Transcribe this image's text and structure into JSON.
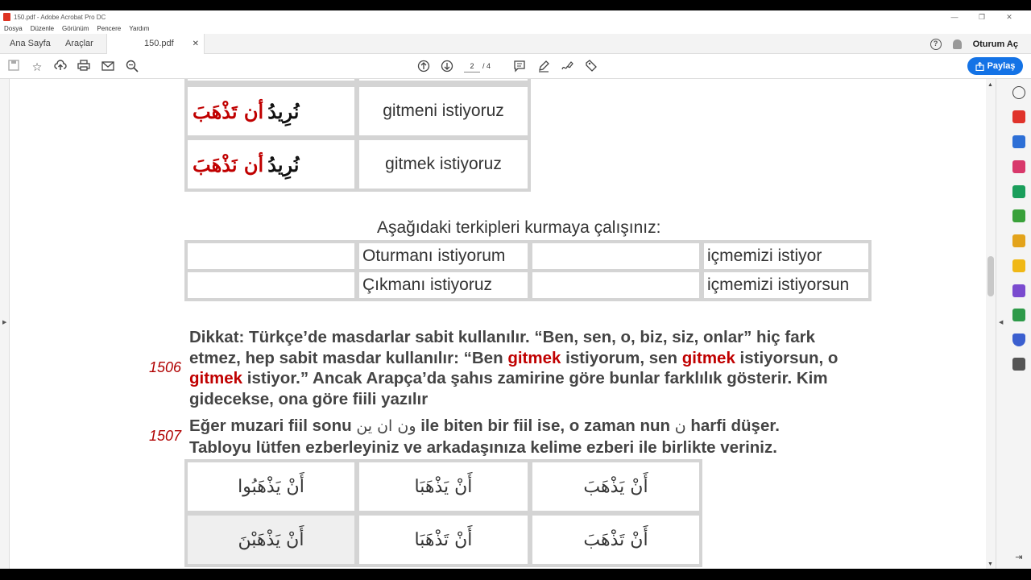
{
  "window": {
    "title": "150.pdf - Adobe Acrobat Pro DC",
    "controls": [
      "—",
      "❐",
      "✕"
    ]
  },
  "menu": [
    "Dosya",
    "Düzenle",
    "Görünüm",
    "Pencere",
    "Yardım"
  ],
  "tabs": {
    "home": "Ana Sayfa",
    "tools": "Araçlar",
    "document": "150.pdf",
    "close": "✕"
  },
  "header_right": {
    "help": "?",
    "sign_in": "Oturum Aç"
  },
  "toolbar": {
    "current_page": "2",
    "total_pages": "/ 4",
    "share_label": "Paylaş"
  },
  "document": {
    "table1": [
      {
        "arabic_black": "نُرِيدُ",
        "arabic_red": "أن تَذْهَبَ",
        "turkish": "gitmeni istiyoruz"
      },
      {
        "arabic_black": "نُرِيدُ",
        "arabic_red": "أن نَذْهَبَ",
        "turkish": "gitmek istiyoruz"
      }
    ],
    "exercise_heading": "Aşağıdaki terkipleri kurmaya çalışınız:",
    "exercise_rows": [
      [
        "",
        "Oturmanı istiyorum",
        "",
        "içmemizi istiyor"
      ],
      [
        "",
        "Çıkmanı istiyoruz",
        "",
        "içmemizi istiyorsun"
      ]
    ],
    "note1": {
      "number": "1506",
      "t1": "Dikkat: Türkçe’de masdarlar sabit kullanılır. “Ben, sen, o, biz, siz, onlar” hiç fark etmez, hep sabit masdar kullanılır: “Ben ",
      "r1": "gitmek",
      "t2": " istiyorum, sen ",
      "r2": "gitmek",
      "t3": " istiyorsun, o ",
      "r3": "gitmek",
      "t4": " istiyor.” Ancak Arapça’da şahıs zamirine göre bunlar farklılık gösterir. Kim gidecekse, ona göre fiili yazılır"
    },
    "note2": {
      "number": "1507",
      "t1": "Eğer muzari fiil sonu ",
      "suffixes": "ون  ان  ين",
      "t2": " ile biten bir fiil ise, o zaman nun ",
      "nun": "ن",
      "t3": " harfi düşer.",
      "line2": "Tabloyu lütfen ezberleyiniz ve arkadaşınıza kelime ezberi ile birlikte veriniz."
    },
    "table2": [
      [
        "أَنْ يَذْهَبُوا",
        "أَنْ يَذْهَبَا",
        "أَنْ يَذْهَبَ"
      ],
      [
        "أَنْ يَذْهَبْنَ",
        "أَنْ تَذْهَبَا",
        "أَنْ تَذْهَبَ"
      ]
    ]
  }
}
